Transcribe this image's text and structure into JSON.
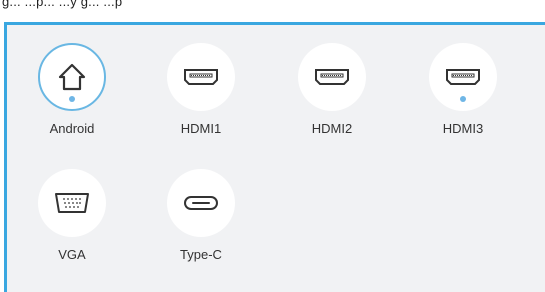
{
  "header": {
    "title_fragment": "g... ...p... ...y g... ...p"
  },
  "sources": [
    {
      "label": "Android",
      "icon": "home-icon",
      "selected": true,
      "active_dot": true
    },
    {
      "label": "HDMI1",
      "icon": "hdmi-port-icon",
      "selected": false,
      "active_dot": false
    },
    {
      "label": "HDMI2",
      "icon": "hdmi-port-icon",
      "selected": false,
      "active_dot": false
    },
    {
      "label": "HDMI3",
      "icon": "hdmi-port-icon",
      "selected": false,
      "active_dot": true
    },
    {
      "label": "VGA",
      "icon": "vga-port-icon",
      "selected": false,
      "active_dot": false
    },
    {
      "label": "Type-C",
      "icon": "usb-c-port-icon",
      "selected": false,
      "active_dot": false
    }
  ],
  "colors": {
    "accent": "#3aa7e0",
    "panel_bg": "#f1f2f4",
    "icon_stroke": "#333333",
    "active_dot": "#6fb6e6"
  }
}
